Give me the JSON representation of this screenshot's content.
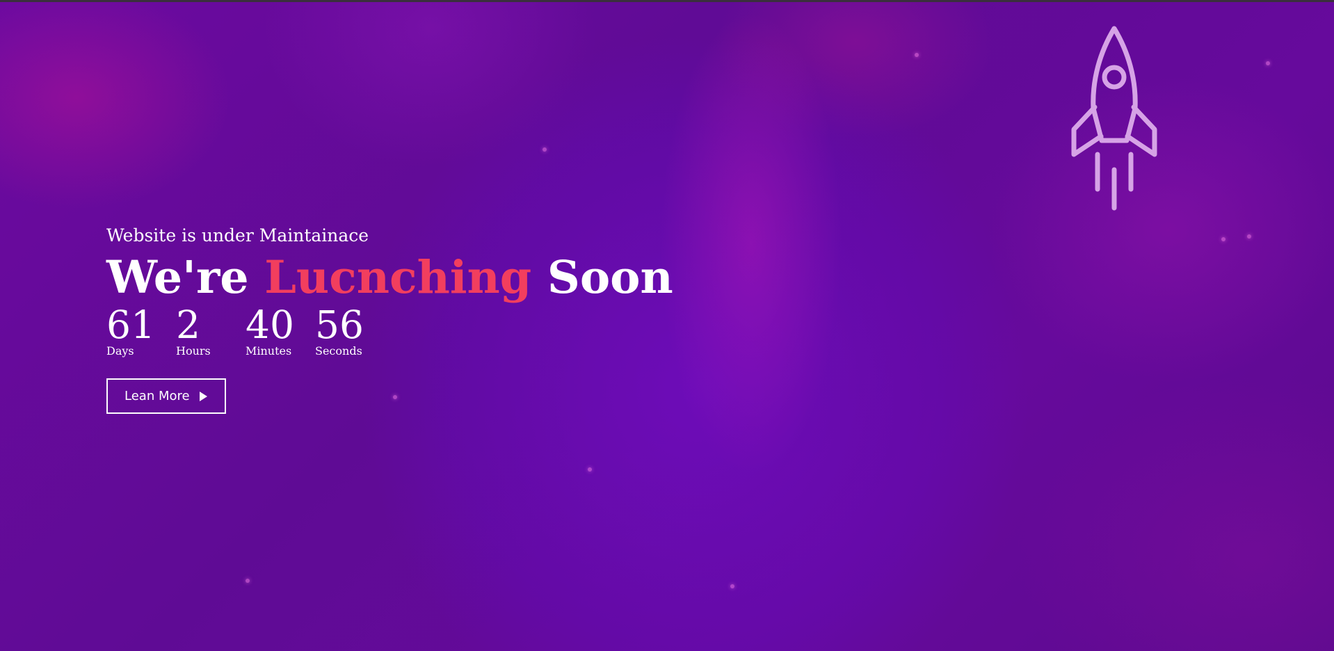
{
  "hero": {
    "subtitle": "Website is under Maintainace",
    "headline_prefix": "We're",
    "headline_accent": "Lucnching",
    "headline_suffix": "Soon"
  },
  "countdown": {
    "days": {
      "value": "61",
      "label": "Days"
    },
    "hours": {
      "value": "2",
      "label": "Hours"
    },
    "minutes": {
      "value": "40",
      "label": "Minutes"
    },
    "seconds": {
      "value": "56",
      "label": "Seconds"
    }
  },
  "cta": {
    "label": "Lean More",
    "icon": "play-icon"
  },
  "decor": {
    "rocket_icon": "rocket-icon"
  },
  "colors": {
    "background": "#5f0a8f",
    "accent": "#f23e5e",
    "text": "#ffffff",
    "rocket": "#d6a3e6"
  }
}
